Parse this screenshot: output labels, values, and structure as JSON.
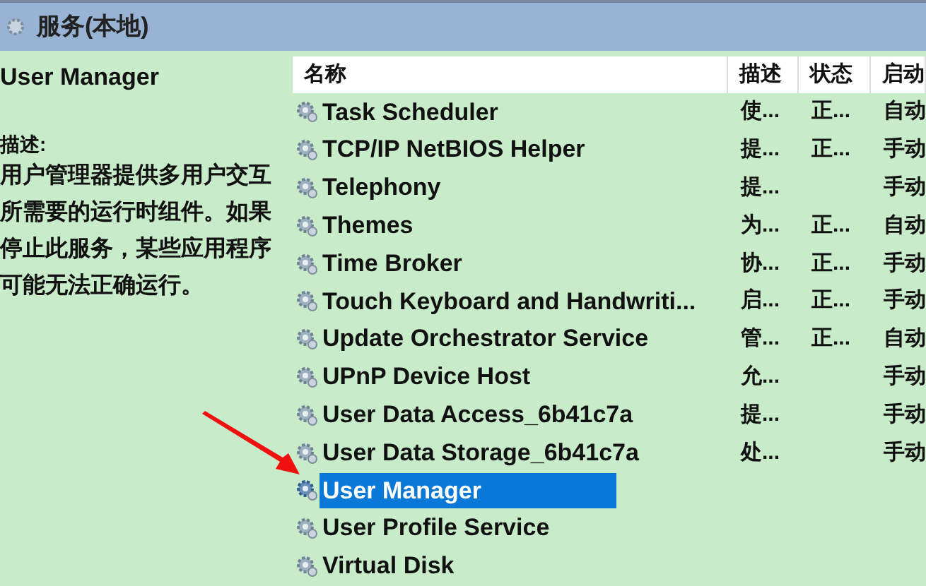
{
  "window": {
    "title": "服务(本地)"
  },
  "details": {
    "name": "User Manager",
    "description_label": "描述:",
    "description": "用户管理器提供多用户交互所需要的运行时组件。如果停止此服务，某些应用程序可能无法正确运行。"
  },
  "table": {
    "columns": [
      "名称",
      "描述",
      "状态",
      "启动"
    ],
    "rows": [
      {
        "name": "Task Scheduler",
        "description": "使...",
        "status": "正...",
        "startup": "自动",
        "selected": false
      },
      {
        "name": "TCP/IP NetBIOS Helper",
        "description": "提...",
        "status": "正...",
        "startup": "手动",
        "selected": false
      },
      {
        "name": "Telephony",
        "description": "提...",
        "startup": "手动",
        "selected": false
      },
      {
        "name": "Themes",
        "description": "为...",
        "status": "正...",
        "startup": "自动",
        "selected": false
      },
      {
        "name": "Time Broker",
        "description": "协...",
        "status": "正...",
        "startup": "手动",
        "selected": false
      },
      {
        "name": "Touch Keyboard and Handwriti...",
        "description": "启...",
        "status": "正...",
        "startup": "手动",
        "selected": false
      },
      {
        "name": "Update Orchestrator Service",
        "description": "管...",
        "status": "正...",
        "startup": "自动",
        "selected": false
      },
      {
        "name": "UPnP Device Host",
        "description": "允...",
        "startup": "手动",
        "selected": false
      },
      {
        "name": "User Data Access_6b41c7a",
        "description": "提...",
        "startup": "手动",
        "selected": false
      },
      {
        "name": "User Data Storage_6b41c7a",
        "description": "处...",
        "startup": "手动",
        "selected": false
      },
      {
        "name": "User Manager",
        "selected": true
      },
      {
        "name": "User Profile Service",
        "selected": false
      },
      {
        "name": "Virtual Disk",
        "selected": false
      }
    ]
  }
}
